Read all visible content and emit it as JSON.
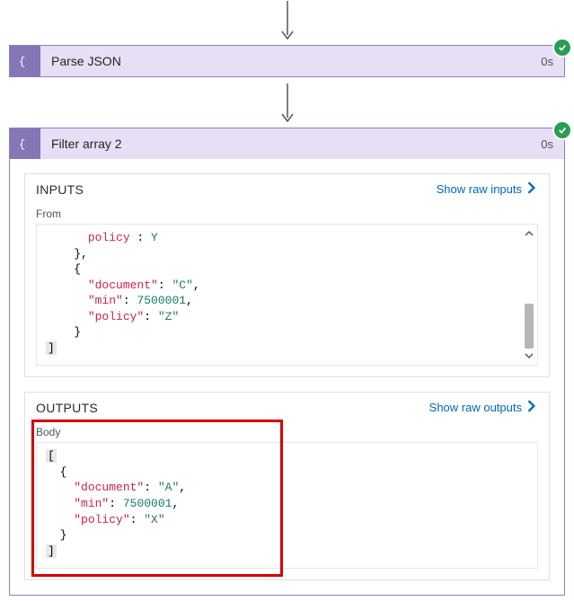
{
  "cards": {
    "parseJson": {
      "title": "Parse JSON",
      "duration": "0s"
    },
    "filterArray2": {
      "title": "Filter array 2",
      "duration": "0s"
    }
  },
  "sections": {
    "inputs": {
      "title": "INPUTS",
      "rawLink": "Show raw inputs",
      "fromLabel": "From"
    },
    "outputs": {
      "title": "OUTPUTS",
      "rawLink": "Show raw outputs",
      "bodyLabel": "Body"
    }
  },
  "inputs_from_snippet": {
    "lines": [
      {
        "indent": 3,
        "tokens": [
          {
            "t": "key",
            "v": "policy"
          },
          {
            "t": "punc",
            "v": " : "
          },
          {
            "t": "str",
            "v": "Y"
          }
        ]
      },
      {
        "indent": 2,
        "tokens": [
          {
            "t": "punc",
            "v": "},"
          }
        ]
      },
      {
        "indent": 2,
        "tokens": [
          {
            "t": "punc",
            "v": "{"
          }
        ]
      },
      {
        "indent": 3,
        "tokens": [
          {
            "t": "key",
            "v": "\"document\""
          },
          {
            "t": "punc",
            "v": ": "
          },
          {
            "t": "str",
            "v": "\"C\""
          },
          {
            "t": "punc",
            "v": ","
          }
        ]
      },
      {
        "indent": 3,
        "tokens": [
          {
            "t": "key",
            "v": "\"min\""
          },
          {
            "t": "punc",
            "v": ": "
          },
          {
            "t": "num",
            "v": "7500001"
          },
          {
            "t": "punc",
            "v": ","
          }
        ]
      },
      {
        "indent": 3,
        "tokens": [
          {
            "t": "key",
            "v": "\"policy\""
          },
          {
            "t": "punc",
            "v": ": "
          },
          {
            "t": "str",
            "v": "\"Z\""
          }
        ]
      },
      {
        "indent": 2,
        "tokens": [
          {
            "t": "punc",
            "v": "}"
          }
        ]
      },
      {
        "indent": 0,
        "tokens": [
          {
            "t": "punc",
            "v": "]"
          }
        ],
        "bg": true
      }
    ]
  },
  "outputs_body_snippet": {
    "lines": [
      {
        "indent": 0,
        "tokens": [
          {
            "t": "punc",
            "v": "["
          }
        ],
        "bg": true
      },
      {
        "indent": 1,
        "tokens": [
          {
            "t": "punc",
            "v": "{"
          }
        ]
      },
      {
        "indent": 2,
        "tokens": [
          {
            "t": "key",
            "v": "\"document\""
          },
          {
            "t": "punc",
            "v": ": "
          },
          {
            "t": "str",
            "v": "\"A\""
          },
          {
            "t": "punc",
            "v": ","
          }
        ]
      },
      {
        "indent": 2,
        "tokens": [
          {
            "t": "key",
            "v": "\"min\""
          },
          {
            "t": "punc",
            "v": ": "
          },
          {
            "t": "num",
            "v": "7500001"
          },
          {
            "t": "punc",
            "v": ","
          }
        ]
      },
      {
        "indent": 2,
        "tokens": [
          {
            "t": "key",
            "v": "\"policy\""
          },
          {
            "t": "punc",
            "v": ": "
          },
          {
            "t": "str",
            "v": "\"X\""
          }
        ]
      },
      {
        "indent": 1,
        "tokens": [
          {
            "t": "punc",
            "v": "}"
          }
        ]
      },
      {
        "indent": 0,
        "tokens": [
          {
            "t": "punc",
            "v": "]"
          }
        ],
        "bg": true
      }
    ]
  }
}
